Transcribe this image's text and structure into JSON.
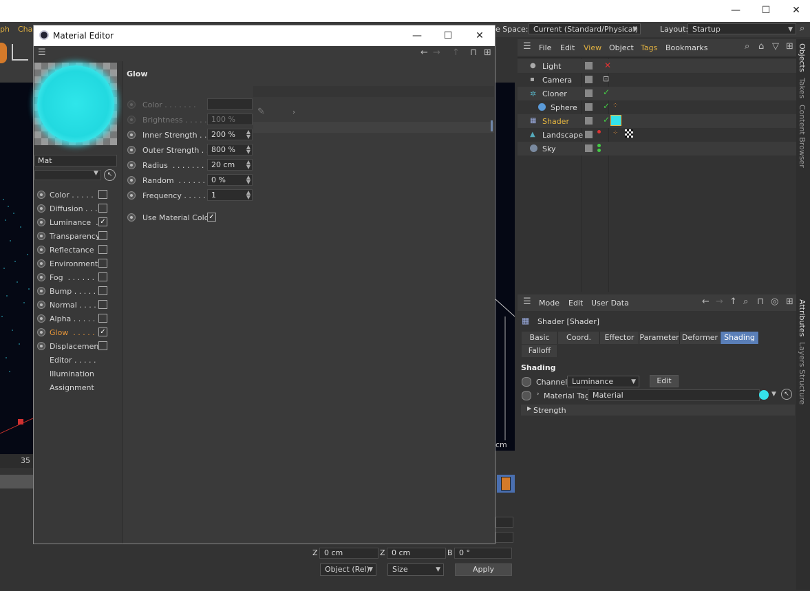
{
  "window": {
    "minimize": "—",
    "maximize": "☐",
    "close": "✕"
  },
  "menubar": {
    "left_items": [
      "ph",
      "Cha"
    ],
    "space_label": "e Space:",
    "space_value": "Current (Standard/Physical)",
    "layout_label": "Layout:",
    "layout_value": "Startup"
  },
  "material_editor": {
    "title": "Material Editor",
    "material_name": "Mat",
    "channels": [
      {
        "label": "Color . . . . .",
        "checked": false,
        "radio": true
      },
      {
        "label": "Diffusion . . .",
        "checked": false,
        "radio": true
      },
      {
        "label": "Luminance  .",
        "checked": true,
        "radio": true
      },
      {
        "label": "Transparency",
        "checked": false,
        "radio": true
      },
      {
        "label": "Reflectance",
        "checked": false,
        "radio": true
      },
      {
        "label": "Environment",
        "checked": false,
        "radio": true
      },
      {
        "label": "Fog  . . . . . .",
        "checked": false,
        "radio": true
      },
      {
        "label": "Bump . . . . .",
        "checked": false,
        "radio": true
      },
      {
        "label": "Normal . . . .",
        "checked": false,
        "radio": true
      },
      {
        "label": "Alpha . . . . .",
        "checked": false,
        "radio": true
      },
      {
        "label": "Glow  . . . . .",
        "checked": true,
        "radio": true,
        "active": true
      },
      {
        "label": "Displacement",
        "checked": false,
        "radio": true
      },
      {
        "label": "Editor . . . . .",
        "checked": null,
        "radio": false
      },
      {
        "label": "Illumination",
        "checked": null,
        "radio": false
      },
      {
        "label": "Assignment",
        "checked": null,
        "radio": false
      }
    ],
    "section_title": "Glow",
    "params": [
      {
        "label": "Color . . . . . . .",
        "value": "",
        "dim": true
      },
      {
        "label": "Brightness . . . . .",
        "value": "100 %",
        "dim": true
      },
      {
        "label": "Inner Strength . .",
        "value": "200 %",
        "dim": false
      },
      {
        "label": "Outer Strength . .",
        "value": "800 %",
        "dim": false
      },
      {
        "label": "Radius  . . . . . . .",
        "value": "20 cm",
        "dim": false
      },
      {
        "label": "Random  . . . . . .",
        "value": "0 %",
        "dim": false
      },
      {
        "label": "Frequency . . . . .",
        "value": "1",
        "dim": false
      }
    ],
    "use_material_color": {
      "label": "Use Material Color",
      "checked": true
    }
  },
  "objects_panel": {
    "menu": [
      "File",
      "Edit",
      "View",
      "Object",
      "Tags",
      "Bookmarks"
    ],
    "rows": [
      {
        "name": "Light",
        "indent": 0,
        "highlight": false
      },
      {
        "name": "Camera",
        "indent": 0,
        "highlight": false
      },
      {
        "name": "Cloner",
        "indent": 0,
        "highlight": false
      },
      {
        "name": "Sphere",
        "indent": 1,
        "highlight": false
      },
      {
        "name": "Shader",
        "indent": 0,
        "highlight": true
      },
      {
        "name": "Landscape",
        "indent": 0,
        "highlight": false
      },
      {
        "name": "Sky",
        "indent": 0,
        "highlight": false
      }
    ]
  },
  "right_tabs_top": [
    "Objects",
    "Takes",
    "Content Browser"
  ],
  "right_tabs_bottom": [
    "Attributes",
    "Layers",
    "Structure"
  ],
  "attributes_panel": {
    "menu": [
      "Mode",
      "Edit",
      "User Data"
    ],
    "object_title": "Shader [Shader]",
    "tabs": [
      "Basic",
      "Coord.",
      "Effector",
      "Parameter",
      "Deformer",
      "Shading",
      "Falloff"
    ],
    "active_tab": "Shading",
    "section": "Shading",
    "channel_label": "Channel",
    "channel_value": "Luminance",
    "edit_button": "Edit",
    "material_tag_label": "Material Tag",
    "material_tag_value": "Material",
    "strength_label": "Strength"
  },
  "viewport": {
    "frame_label": "35",
    "unit_label": "cm"
  },
  "coords": {
    "z1_label": "Z",
    "z1_value": "0 cm",
    "z2_label": "Z",
    "z2_value": "0 cm",
    "b_label": "B",
    "b_value": "0 °",
    "mode_value": "Object (Rel)",
    "size_value": "Size",
    "apply": "Apply"
  }
}
